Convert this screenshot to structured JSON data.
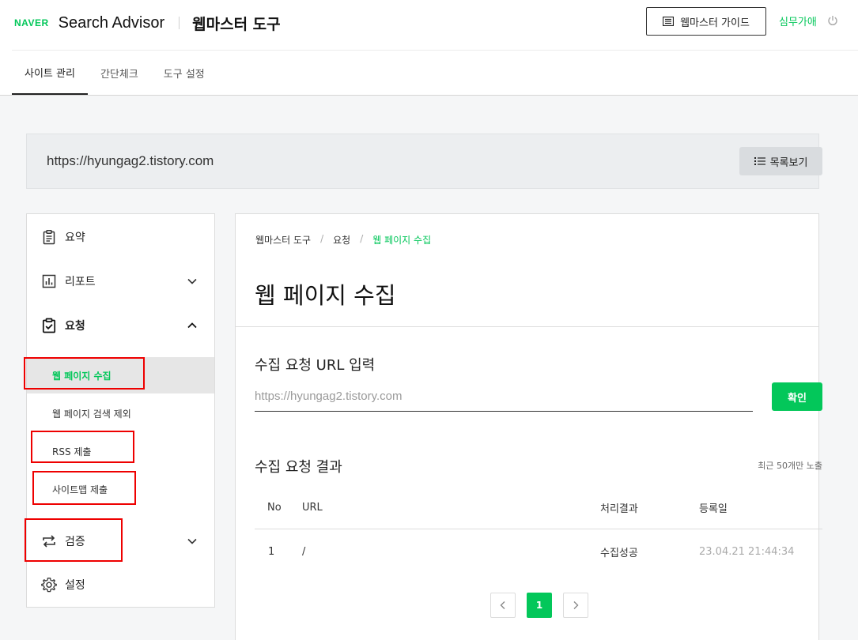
{
  "header": {
    "naver_logo": "NAVER",
    "app_title": "Search Advisor",
    "section_title": "웹마스터 도구",
    "guide_button": "웹마스터 가이드",
    "user_name": "심무가애"
  },
  "tabs": [
    {
      "label": "사이트 관리",
      "active": true
    },
    {
      "label": "간단체크",
      "active": false
    },
    {
      "label": "도구 설정",
      "active": false
    }
  ],
  "site": {
    "url": "https://hyungag2.tistory.com",
    "list_button": "목록보기"
  },
  "sidebar": {
    "summary": "요약",
    "report": "리포트",
    "request": "요청",
    "request_items": [
      "웹 페이지 수집",
      "웹 페이지 검색 제외",
      "RSS 제출",
      "사이트맵 제출"
    ],
    "verify": "검증",
    "settings": "설정"
  },
  "content": {
    "breadcrumb": [
      "웹마스터 도구",
      "요청",
      "웹 페이지 수집"
    ],
    "breadcrumb_sep": "/",
    "title": "웹 페이지 수집",
    "input_section_title": "수집 요청 URL 입력",
    "input_placeholder": "https://hyungag2.tistory.com",
    "confirm_button": "확인",
    "result_section_title": "수집 요청 결과",
    "result_note": "최근 50개만 노출",
    "table": {
      "headers": [
        "No",
        "URL",
        "처리결과",
        "등록일"
      ],
      "rows": [
        [
          "1",
          "/",
          "수집성공",
          "23.04.21 21:44:34"
        ]
      ]
    },
    "pagination": {
      "current": "1"
    }
  },
  "colors": {
    "accent": "#03c75a",
    "highlight": "#e00000"
  }
}
